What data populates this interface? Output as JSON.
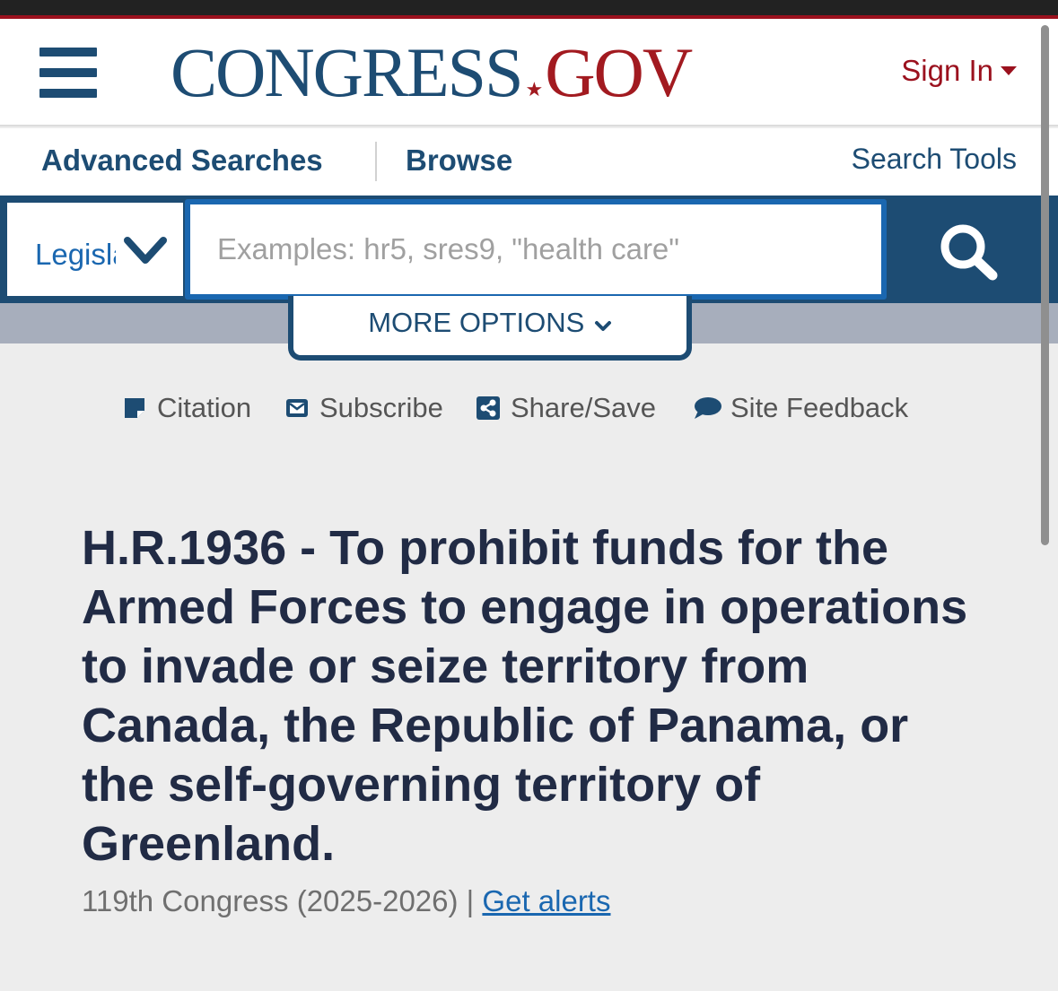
{
  "header": {
    "logo_main": "CONGRESS",
    "logo_star": "★",
    "logo_tld": "GOV",
    "sign_in_label": "Sign In"
  },
  "subnav": {
    "advanced_searches_label": "Advanced Searches",
    "browse_label": "Browse",
    "search_tools_label": "Search Tools"
  },
  "search": {
    "collection_value": "Legislation",
    "placeholder": "Examples: hr5, sres9, \"health care\"",
    "more_options_label": "MORE OPTIONS"
  },
  "tools": {
    "citation_label": "Citation",
    "subscribe_label": "Subscribe",
    "share_label": "Share/Save",
    "feedback_label": "Site Feedback"
  },
  "bill": {
    "title": "H.R.1936 - To prohibit funds for the Armed Forces to engage in operations to invade or seize territory from Canada, the Republic of Panama, or the self-governing territory of Greenland.",
    "congress": "119th Congress (2025-2026)",
    "separator": " | ",
    "alerts_link": "Get alerts"
  },
  "colors": {
    "brand_blue": "#1d4c73",
    "brand_red": "#9b111e",
    "link_blue": "#1a67b0",
    "title_navy": "#212b45"
  },
  "icons": [
    "menu-icon",
    "caret-down-icon",
    "chevron-down-icon",
    "search-icon",
    "citation-icon",
    "envelope-icon",
    "share-icon",
    "comment-icon"
  ]
}
